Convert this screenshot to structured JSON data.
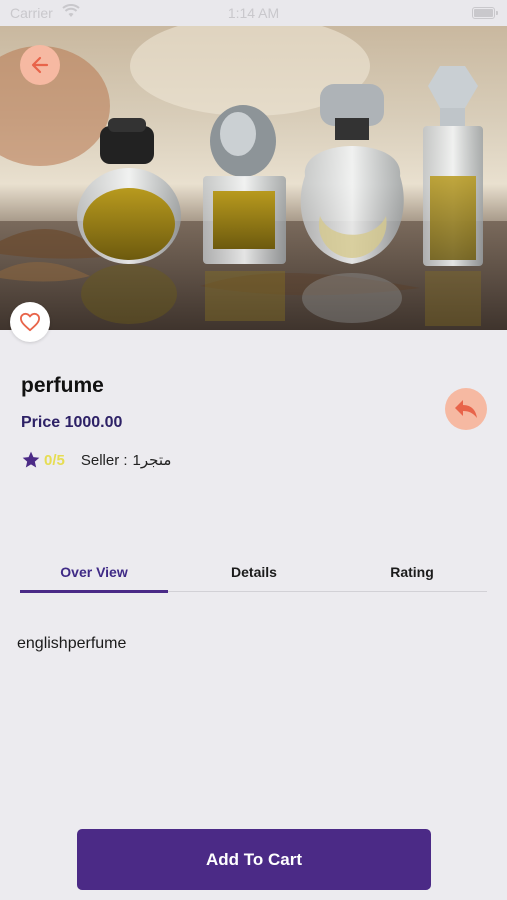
{
  "status_bar": {
    "carrier": "Carrier",
    "time": "1:14 AM"
  },
  "product": {
    "title": "perfume",
    "price": "Price 1000.00",
    "rating": "0/5",
    "seller_label": "Seller :",
    "seller_name": "متجر1"
  },
  "tabs": [
    {
      "label": "Over View",
      "active": true
    },
    {
      "label": "Details",
      "active": false
    },
    {
      "label": "Rating",
      "active": false
    }
  ],
  "overview": {
    "description": "englishperfume"
  },
  "actions": {
    "add_to_cart_label": "Add To Cart"
  },
  "icons": {
    "back": "arrow-left-icon",
    "favorite": "heart-outline-icon",
    "share": "reply-arrow-icon",
    "star": "star-icon"
  },
  "colors": {
    "primary": "#4b2a86",
    "accent_soft": "#f6b9a2",
    "accent_icon": "#e8644a",
    "price_text": "#2d2166",
    "rating_text": "#e6dd52",
    "background": "#ecebef"
  }
}
